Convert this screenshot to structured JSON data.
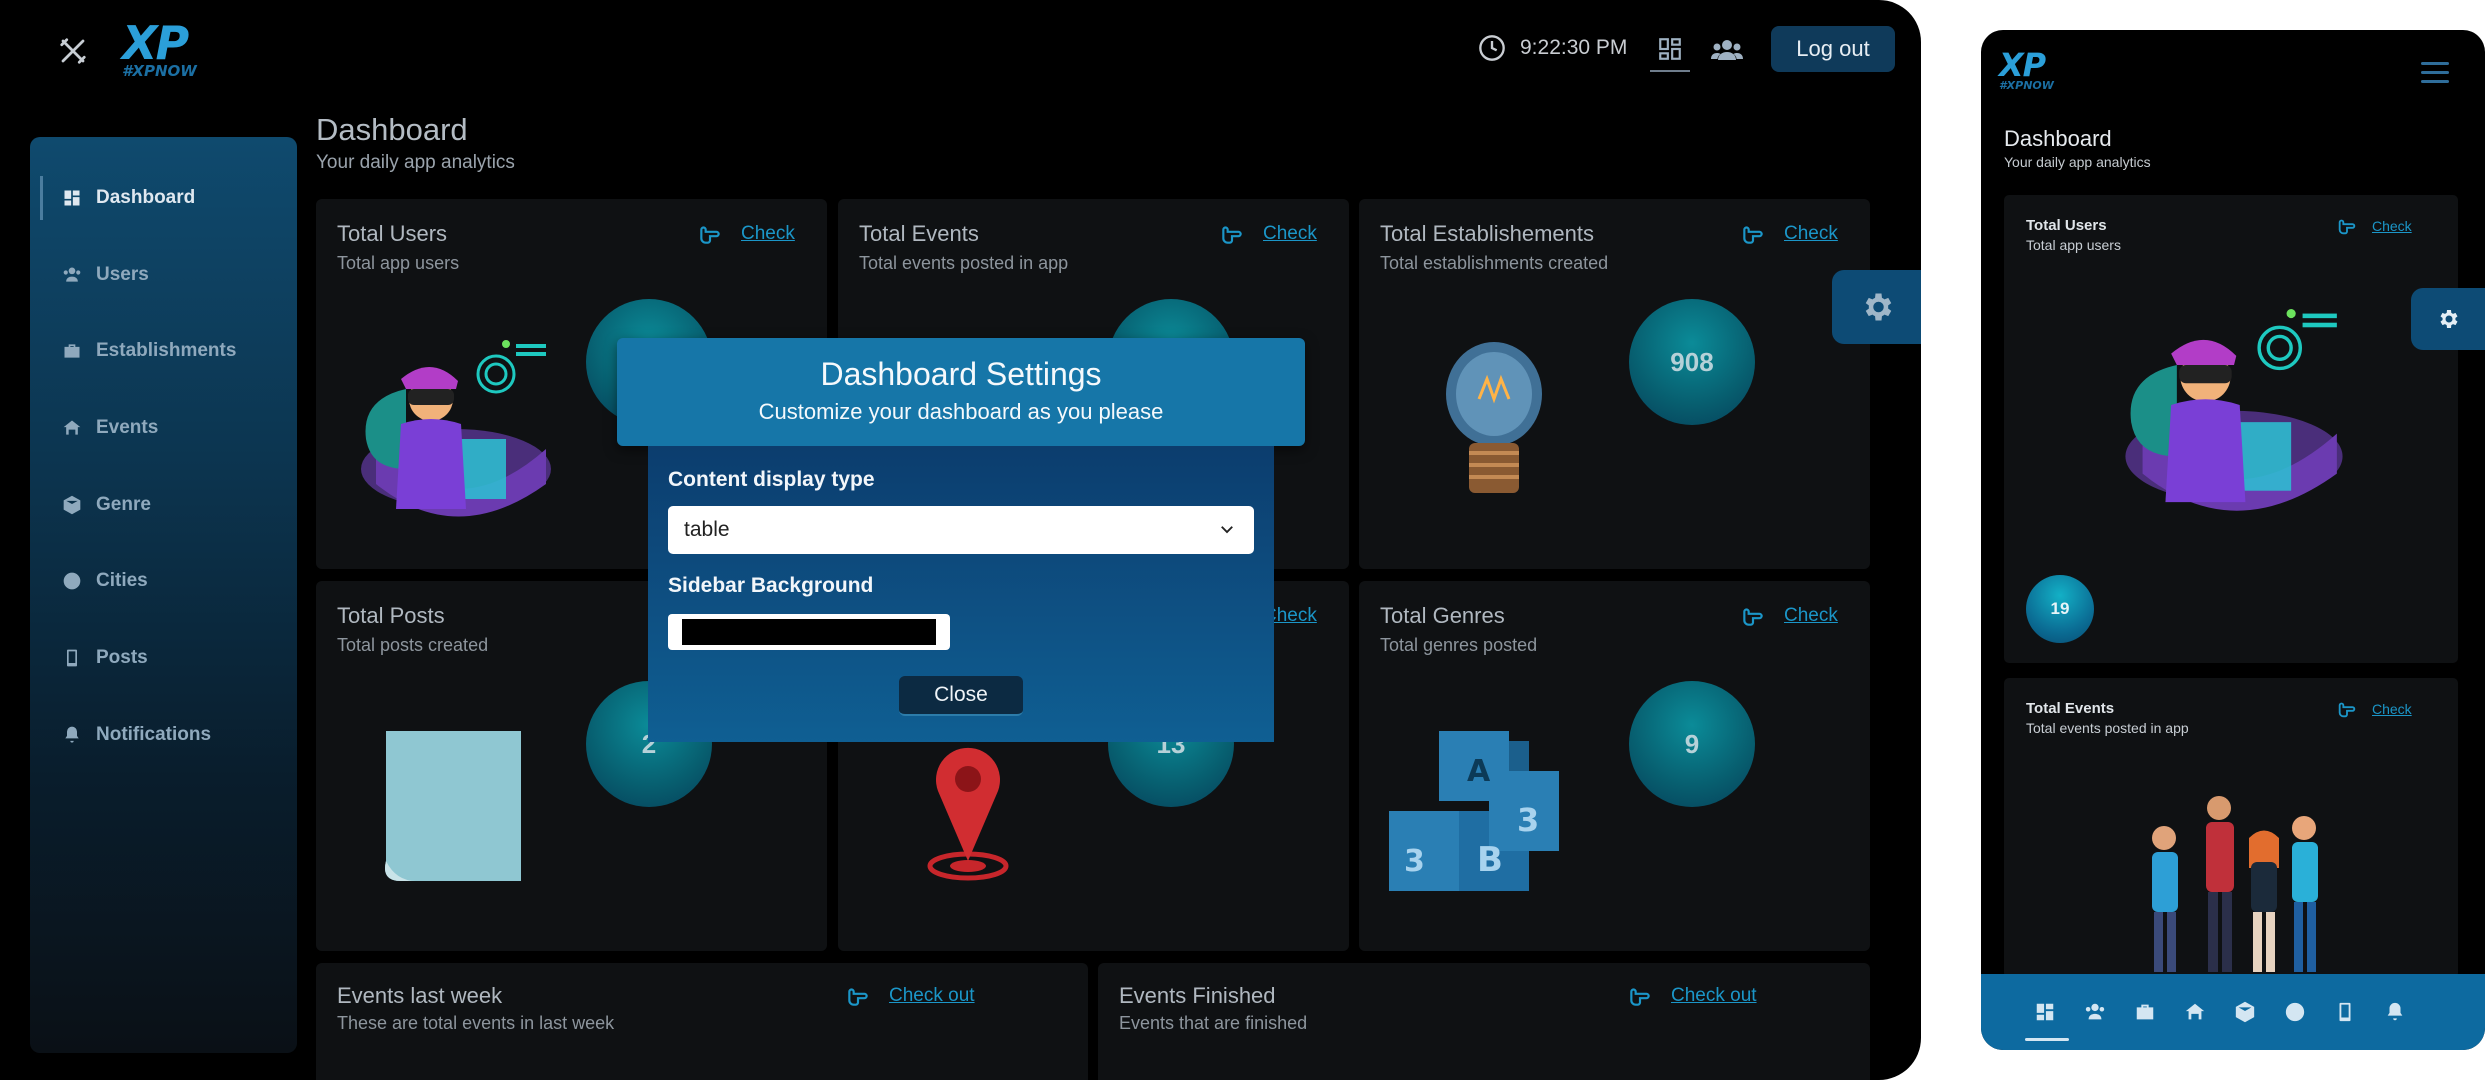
{
  "brand": {
    "logo_text": "XP",
    "logo_tag": "#XPNOW"
  },
  "header": {
    "time": "9:22:30 PM",
    "logout_label": "Log out"
  },
  "sidebar": {
    "items": [
      {
        "label": "Dashboard",
        "icon": "dashboard-icon",
        "active": true
      },
      {
        "label": "Users",
        "icon": "users-icon"
      },
      {
        "label": "Establishments",
        "icon": "briefcase-icon"
      },
      {
        "label": "Events",
        "icon": "events-icon"
      },
      {
        "label": "Genre",
        "icon": "cube-icon"
      },
      {
        "label": "Cities",
        "icon": "globe-icon"
      },
      {
        "label": "Posts",
        "icon": "phone-icon"
      },
      {
        "label": "Notifications",
        "icon": "bell-icon"
      }
    ]
  },
  "page": {
    "title": "Dashboard",
    "subtitle": "Your daily app analytics"
  },
  "cards": {
    "users": {
      "title": "Total Users",
      "subtitle": "Total app users",
      "check": "Check"
    },
    "events": {
      "title": "Total Events",
      "subtitle": "Total events posted in app",
      "check": "Check"
    },
    "establishments": {
      "title": "Total Establishements",
      "subtitle": "Total establishments created",
      "check": "Check",
      "value": "908"
    },
    "posts": {
      "title": "Total Posts",
      "subtitle": "Total posts created",
      "value": "2"
    },
    "cities": {
      "check": "Check",
      "value": "13"
    },
    "genres": {
      "title": "Total Genres",
      "subtitle": "Total genres posted",
      "check": "Check",
      "value": "9"
    },
    "events_last_week": {
      "title": "Events last week",
      "subtitle": "These are total events in last week",
      "check": "Check out"
    },
    "events_finished": {
      "title": "Events Finished",
      "subtitle": "Events that are finished",
      "check": "Check out"
    }
  },
  "modal": {
    "title": "Dashboard Settings",
    "subtitle": "Customize your dashboard as you please",
    "display_label": "Content display type",
    "display_value": "table",
    "sidebar_bg_label": "Sidebar Background",
    "sidebar_bg_value": "#000000",
    "close_label": "Close"
  },
  "mobile": {
    "title": "Dashboard",
    "subtitle": "Your daily app analytics",
    "cards": [
      {
        "title": "Total Users",
        "subtitle": "Total app users",
        "check": "Check",
        "value": "19"
      },
      {
        "title": "Total Events",
        "subtitle": "Total events posted in app",
        "check": "Check"
      }
    ]
  },
  "colors": {
    "accent": "#1676a8",
    "link": "#1b96c8",
    "sidebar_top": "#0f4a6e",
    "bottom_nav": "#0d6aa0"
  }
}
